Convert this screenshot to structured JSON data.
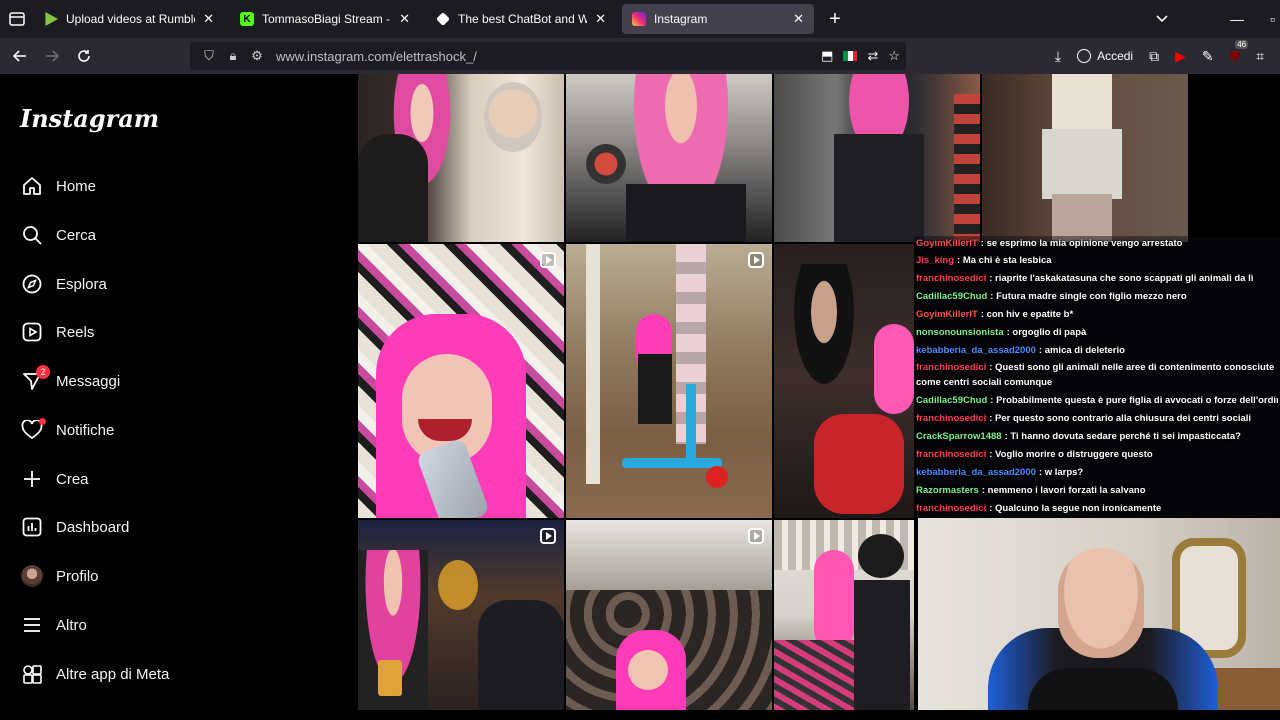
{
  "browser": {
    "tabs": [
      {
        "title": "Upload videos at Rumble",
        "favicon_color": "#85c742",
        "active": false
      },
      {
        "title": "TommasoBiagi Stream - Watch",
        "favicon_color": "#53fc18",
        "active": false
      },
      {
        "title": "The best ChatBot and Widgets",
        "favicon_color": "#ffffff",
        "active": false
      },
      {
        "title": "Instagram",
        "favicon_color": "#e1306c",
        "active": true
      }
    ],
    "new_tab_symbol": "+",
    "url": "www.instagram.com/elettrashock_/",
    "signin_label": "Accedi",
    "extension_badge": "46"
  },
  "sidebar": {
    "logo": "Instagram",
    "items": [
      {
        "label": "Home",
        "icon": "home-icon"
      },
      {
        "label": "Cerca",
        "icon": "search-icon"
      },
      {
        "label": "Esplora",
        "icon": "compass-icon"
      },
      {
        "label": "Reels",
        "icon": "reels-icon"
      },
      {
        "label": "Messaggi",
        "icon": "messenger-icon",
        "badge": "2"
      },
      {
        "label": "Notifiche",
        "icon": "heart-icon"
      },
      {
        "label": "Crea",
        "icon": "plus-icon"
      },
      {
        "label": "Dashboard",
        "icon": "dashboard-icon"
      },
      {
        "label": "Profilo",
        "icon": "avatar-icon"
      },
      {
        "label": "Altro",
        "icon": "menu-icon"
      },
      {
        "label": "Altre app di Meta",
        "icon": "meta-apps-icon"
      }
    ]
  },
  "chat": {
    "messages": [
      {
        "user": "GoyimKillerIT",
        "text": ": se esprimo la mia opinione vengo arrestato",
        "color": "#ff4d4d"
      },
      {
        "user": "Jis_king",
        "text": ": Ma chi è sta lesbica",
        "color": "#ff3b5c"
      },
      {
        "user": "franchinosedici",
        "text": ": riaprite l'askakatasuna che sono scappati gli animali da lì",
        "color": "#ff3b5c"
      },
      {
        "user": "Cadillac59Chud",
        "text": ": Futura madre single con figlio mezzo nero",
        "color": "#7cf08c"
      },
      {
        "user": "GoyimKillerIT",
        "text": ": con hiv e epatite b*",
        "color": "#ff4d4d"
      },
      {
        "user": "nonsonounsionista",
        "text": ": orgoglio di papà",
        "color": "#7cf08c"
      },
      {
        "user": "kebabberia_da_assad2000",
        "text": ": amica di deleterio",
        "color": "#4b8cff"
      },
      {
        "user": "franchinosedici",
        "text": ": Questi sono gli animali nelle aree di contenimento conosciute come centri sociali comunque",
        "color": "#ff3b5c"
      },
      {
        "user": "Cadillac59Chud",
        "text": ": Probabilmente questa è pure figlia di avvocati o forze dell'ordine",
        "color": "#7cf08c"
      },
      {
        "user": "franchinosedici",
        "text": ": Per questo sono contrario alla chiusura dei centri sociali",
        "color": "#ff3b5c"
      },
      {
        "user": "CrackSparrow1488",
        "text": ": Ti hanno dovuta sedare perché ti sei impasticcata?",
        "color": "#7cf08c"
      },
      {
        "user": "franchinosedici",
        "text": ": Voglio morire o distruggere questo",
        "color": "#ff3b5c"
      },
      {
        "user": "kebabberia_da_assad2000",
        "text": ": w larps?",
        "color": "#4b8cff"
      },
      {
        "user": "Razormasters",
        "text": ": nemmeno i lavori forzati la salvano",
        "color": "#7cf08c"
      },
      {
        "user": "franchinosedici",
        "text": ": Qualcuno la segue non ironicamente",
        "color": "#ff3b5c"
      }
    ]
  },
  "colors": {
    "tabbar_bg": "#1c1b22",
    "navbar_bg": "#2b2a33",
    "notification_red": "#ff3040",
    "hair_pink": "#e8399a"
  }
}
